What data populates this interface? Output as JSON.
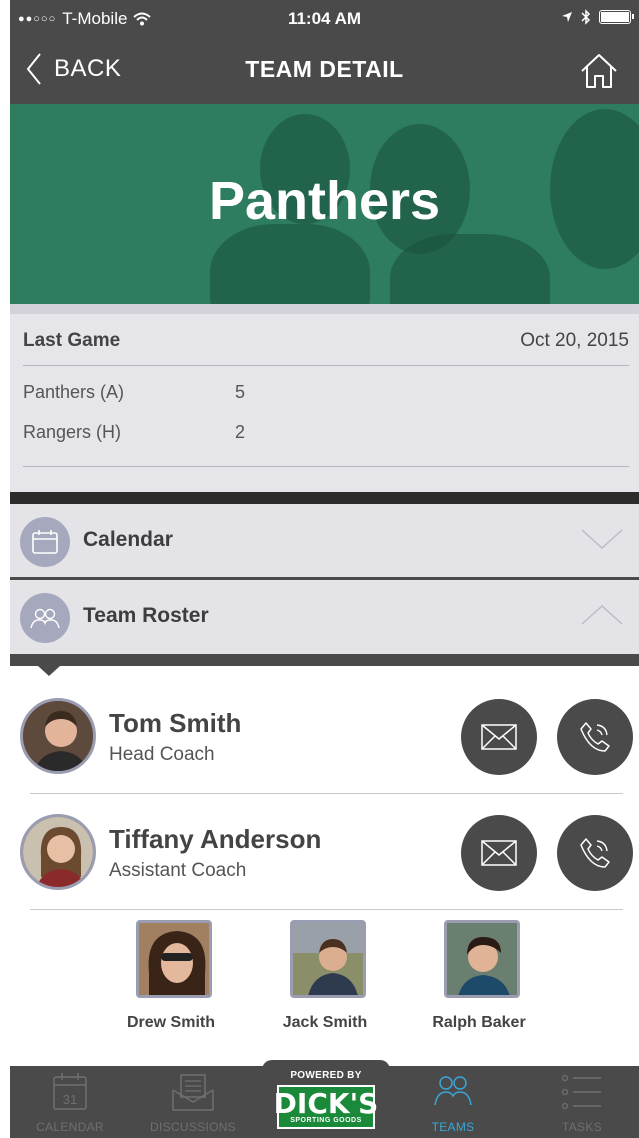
{
  "status_bar": {
    "carrier": "T-Mobile",
    "time": "11:04 AM"
  },
  "nav": {
    "back_label": "BACK",
    "title": "TEAM DETAIL"
  },
  "hero": {
    "team_name": "Panthers"
  },
  "last_game": {
    "heading": "Last Game",
    "date": "Oct 20, 2015",
    "results": [
      {
        "team": "Panthers (A)",
        "score": "5"
      },
      {
        "team": "Rangers (H)",
        "score": "2"
      }
    ]
  },
  "sections": {
    "calendar_label": "Calendar",
    "roster_label": "Team Roster"
  },
  "coaches": [
    {
      "name": "Tom Smith",
      "role": "Head Coach"
    },
    {
      "name": "Tiffany Anderson",
      "role": "Assistant Coach"
    }
  ],
  "players": [
    {
      "name": "Drew Smith"
    },
    {
      "name": "Jack Smith"
    },
    {
      "name": "Ralph Baker"
    }
  ],
  "tab_bar": {
    "calendar_label": "CALENDAR",
    "calendar_day": "31",
    "discussions_label": "DISCUSSIONS",
    "sponsor_powered": "POWERED BY",
    "sponsor_brand": "DICK'S",
    "sponsor_sub": "SPORTING GOODS",
    "teams_label": "TEAMS",
    "tasks_label": "TASKS",
    "active_tab": "TEAMS"
  },
  "colors": {
    "header": "#4a4a4a",
    "hero_green": "#2d7d5e",
    "section_bg": "#e4e3e8",
    "accent_active": "#3aa6d8",
    "sponsor_green": "#1a8a3a"
  },
  "icons": {
    "back": "chevron-left-icon",
    "home": "home-icon",
    "calendar_section": "calendar-icon",
    "roster_section": "people-icon",
    "calendar_chevron": "chevron-down-icon",
    "roster_chevron": "chevron-up-icon",
    "email": "envelope-icon",
    "phone": "phone-icon"
  }
}
